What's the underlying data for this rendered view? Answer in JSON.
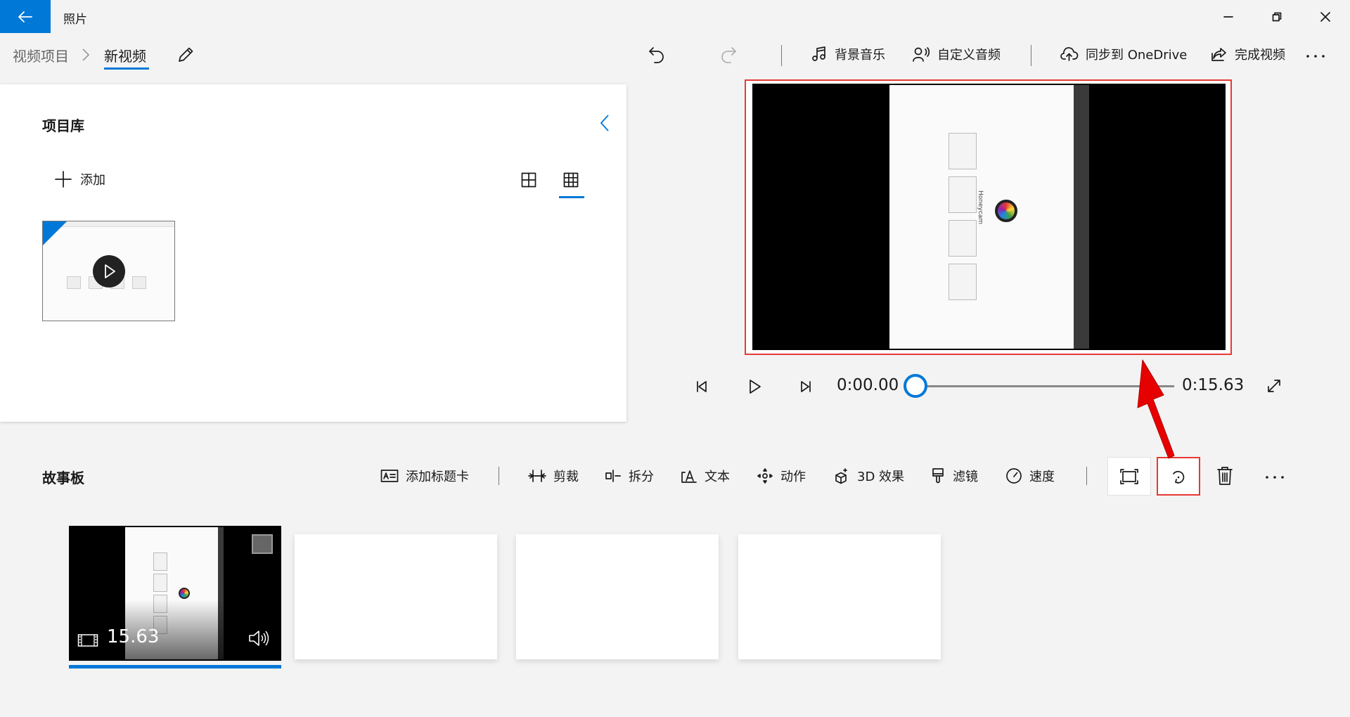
{
  "app": {
    "title": "照片"
  },
  "breadcrumb": {
    "root": "视频项目",
    "current": "新视频"
  },
  "toolbar": {
    "background_music": "背景音乐",
    "custom_audio": "自定义音频",
    "sync_onedrive": "同步到 OneDrive",
    "finish_video": "完成视频",
    "more": "..."
  },
  "library": {
    "title": "项目库",
    "add_label": "添加",
    "selected_view": "grid-small"
  },
  "player": {
    "current_time": "0:00.00",
    "total_time": "0:15.63",
    "progress": 0
  },
  "storyboard": {
    "title": "故事板",
    "tools": {
      "add_title_card": "添加标题卡",
      "trim": "剪裁",
      "split": "拆分",
      "text": "文本",
      "motion": "动作",
      "effects_3d": "3D 效果",
      "filters": "滤镜",
      "speed": "速度"
    },
    "more": "...",
    "clips": [
      {
        "duration": "15.63",
        "selected": true
      }
    ],
    "empty_slots": 3
  },
  "clip_content": {
    "brand": "Honeycam"
  },
  "colors": {
    "accent": "#0078d7",
    "highlight": "#e53935"
  }
}
